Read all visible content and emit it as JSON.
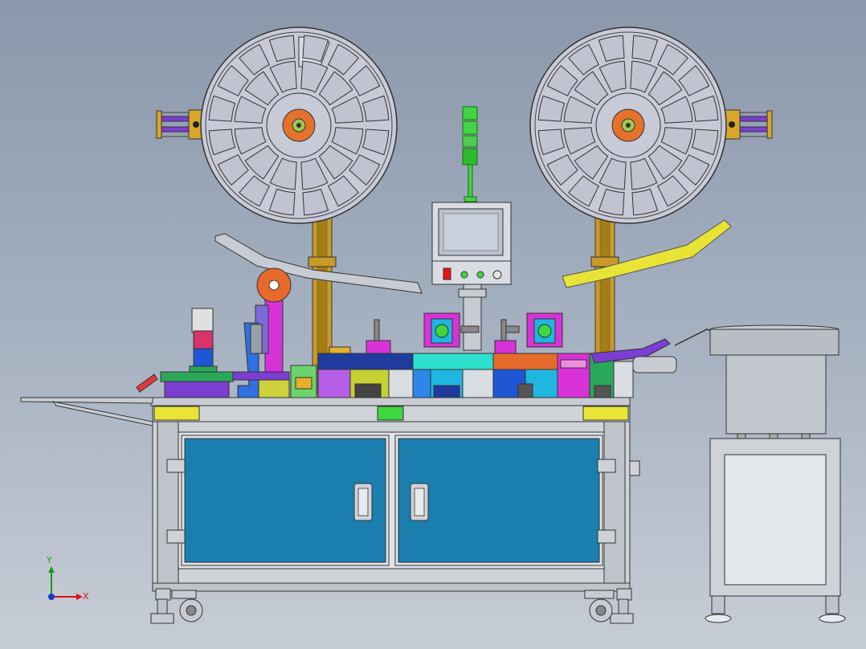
{
  "triad": {
    "x_label": "X",
    "y_label": "Y"
  },
  "colors": {
    "cabinet_door": "#1a7fae",
    "frame": "#cfd3d8",
    "reel": "#c8cad8",
    "hub": "#e5722c",
    "post": "#c79a2a",
    "guide_yellow": "#e8e436",
    "bowl": "#b9bec4",
    "signal_green": "#3fd63f"
  }
}
